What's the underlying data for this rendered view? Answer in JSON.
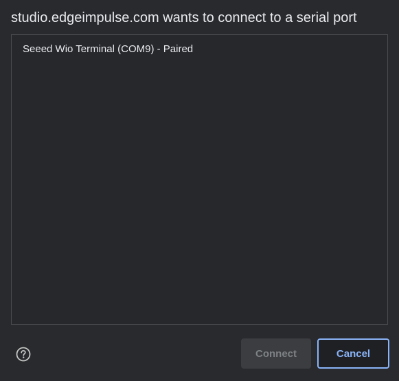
{
  "dialog": {
    "title": "studio.edgeimpulse.com wants to connect to a serial port"
  },
  "devices": [
    {
      "label": "Seeed Wio Terminal (COM9) - Paired"
    }
  ],
  "footer": {
    "help_icon": "question-circle-icon",
    "connect_label": "Connect",
    "cancel_label": "Cancel"
  },
  "colors": {
    "background": "#292a2d",
    "accent": "#8ab4f8",
    "disabled_text": "#7e8185"
  }
}
